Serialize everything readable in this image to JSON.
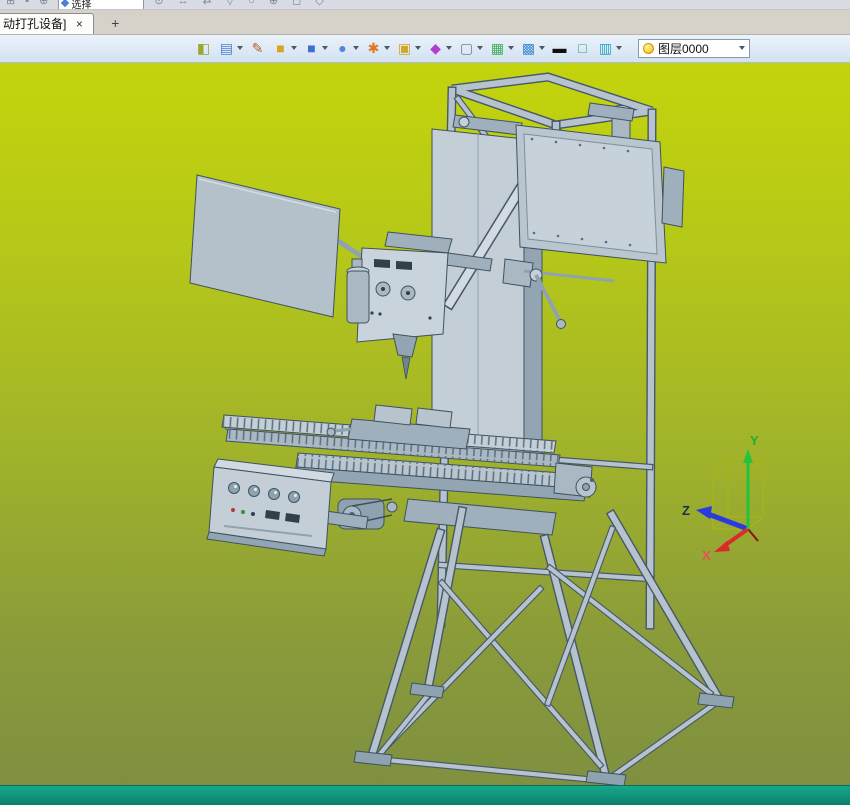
{
  "window": {
    "tab": {
      "title": "动打孔设备]",
      "close_label": "×",
      "new_tab_label": "+"
    }
  },
  "top_strip": {
    "selector": {
      "label": "选择"
    },
    "icons_left": [
      {
        "name": "grid-icon",
        "glyph": "⊞"
      },
      {
        "name": "pin-icon",
        "glyph": "▪"
      },
      {
        "name": "add-icon",
        "glyph": "⊕"
      }
    ],
    "icons_right": [
      {
        "name": "orbit-icon",
        "glyph": "⊙"
      },
      {
        "name": "pan-icon",
        "glyph": "↔"
      },
      {
        "name": "swap-icon",
        "glyph": "⇄"
      },
      {
        "name": "down-icon",
        "glyph": "▽"
      },
      {
        "name": "circle-icon",
        "glyph": "○"
      },
      {
        "name": "target-icon",
        "glyph": "⊕"
      },
      {
        "name": "frame-icon",
        "glyph": "◻"
      },
      {
        "name": "diamond-icon",
        "glyph": "◇"
      }
    ]
  },
  "toolbar": {
    "layer_combo": {
      "value": "图层0000"
    },
    "icons": [
      {
        "name": "exit-door-icon",
        "glyph": "◧",
        "color": "#9aa832",
        "dropdown": false
      },
      {
        "name": "render-palette-icon",
        "glyph": "▤",
        "color": "#4a7fd4",
        "dropdown": true
      },
      {
        "name": "pen-icon",
        "glyph": "✎",
        "color": "#b3622a",
        "dropdown": false
      },
      {
        "name": "gold-cube-icon",
        "glyph": "■",
        "color": "#d9a41f",
        "dropdown": true
      },
      {
        "name": "blue-cube-icon",
        "glyph": "■",
        "color": "#3f6fd1",
        "dropdown": true
      },
      {
        "name": "blue-sphere-icon",
        "glyph": "●",
        "color": "#4f86d8",
        "dropdown": true
      },
      {
        "name": "orange-wheel-icon",
        "glyph": "✱",
        "color": "#e07820",
        "dropdown": true
      },
      {
        "name": "yellow-box-icon",
        "glyph": "▣",
        "color": "#d1a825",
        "dropdown": true
      },
      {
        "name": "purple-diamond-icon",
        "glyph": "◆",
        "color": "#b03fd1",
        "dropdown": true
      },
      {
        "name": "white-board-icon",
        "glyph": "▢",
        "color": "#6f8292",
        "dropdown": true
      },
      {
        "name": "green-table-icon",
        "glyph": "▦",
        "color": "#3fae5a",
        "dropdown": true
      },
      {
        "name": "color-grid-icon",
        "glyph": "▩",
        "color": "#3f8ad1",
        "dropdown": true
      },
      {
        "name": "black-line-icon",
        "glyph": "▬",
        "color": "#101010",
        "dropdown": false
      },
      {
        "name": "teal-frame-icon",
        "glyph": "□",
        "color": "#2e9e8e",
        "dropdown": false
      },
      {
        "name": "cyan-layers-icon",
        "glyph": "▥",
        "color": "#27a8c4",
        "dropdown": true
      }
    ]
  },
  "viewport": {
    "background_top": "#c3d40c",
    "background_bottom": "#7f9040",
    "model_color": "#b6c3ce",
    "axes": {
      "x": {
        "label": "X",
        "color": "#e05555"
      },
      "y": {
        "label": "Y",
        "color": "#1fae36"
      },
      "z": {
        "label": "Z",
        "color": "#2a3bdd"
      }
    }
  },
  "status_bar": {
    "color": "#12a384"
  }
}
